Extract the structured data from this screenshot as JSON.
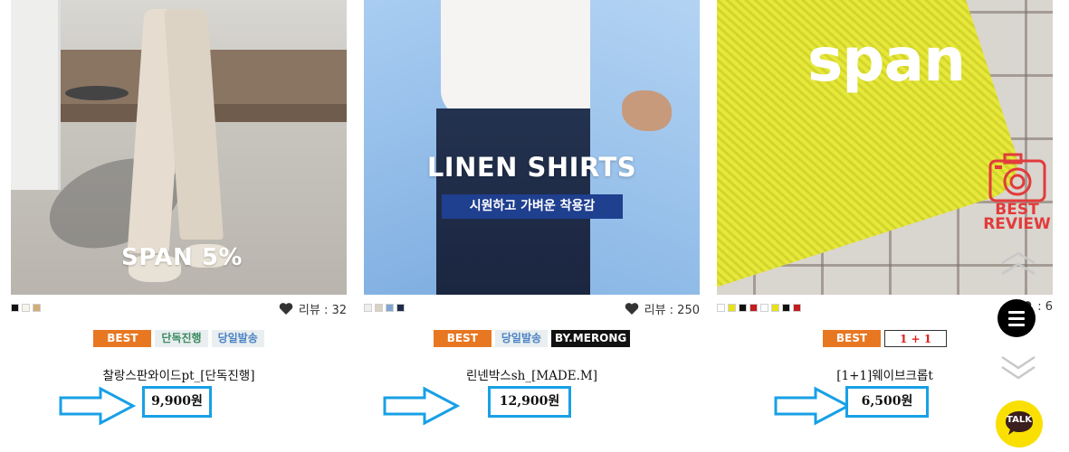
{
  "products": [
    {
      "image_text": "SPAN 5%",
      "swatches": [
        "#111111",
        "#f7f4ea",
        "#d2ad7a"
      ],
      "review_label": "리뷰 : 32",
      "badges": [
        "BEST",
        "단독진행",
        "당일발송"
      ],
      "name": "찰랑스판와이드pt_[단독진행]",
      "price": "9,900원"
    },
    {
      "image_title": "LINEN SHIRTS",
      "image_subtitle": "시원하고 가벼운 착용감",
      "swatches": [
        "#eeeeee",
        "#d8d2c4",
        "#7fa5d4",
        "#1f2c4a"
      ],
      "review_label": "리뷰 : 250",
      "badges": [
        "BEST",
        "당일발송",
        "BY.MERONG"
      ],
      "name": "린넨박스sh_[MADE.M]",
      "price": "12,900원"
    },
    {
      "image_logo": "span",
      "image_badge": [
        "BEST",
        "REVIEW"
      ],
      "swatches": [
        "#ffffff",
        "#e8e11a",
        "#111111",
        "#c31d1d",
        "#ffffff",
        "#e8e11a",
        "#111111",
        "#c31d1d"
      ],
      "review_label": ": 6",
      "badges": [
        "BEST",
        "1 + 1"
      ],
      "name": "[1+1]웨이브크롭t",
      "price": "6,500원"
    }
  ],
  "floating": {
    "talk_label": "TALK"
  },
  "colors": {
    "highlight_blue": "#18a0e6",
    "best_orange": "#e87722",
    "kakao_yellow": "#f9e000"
  }
}
